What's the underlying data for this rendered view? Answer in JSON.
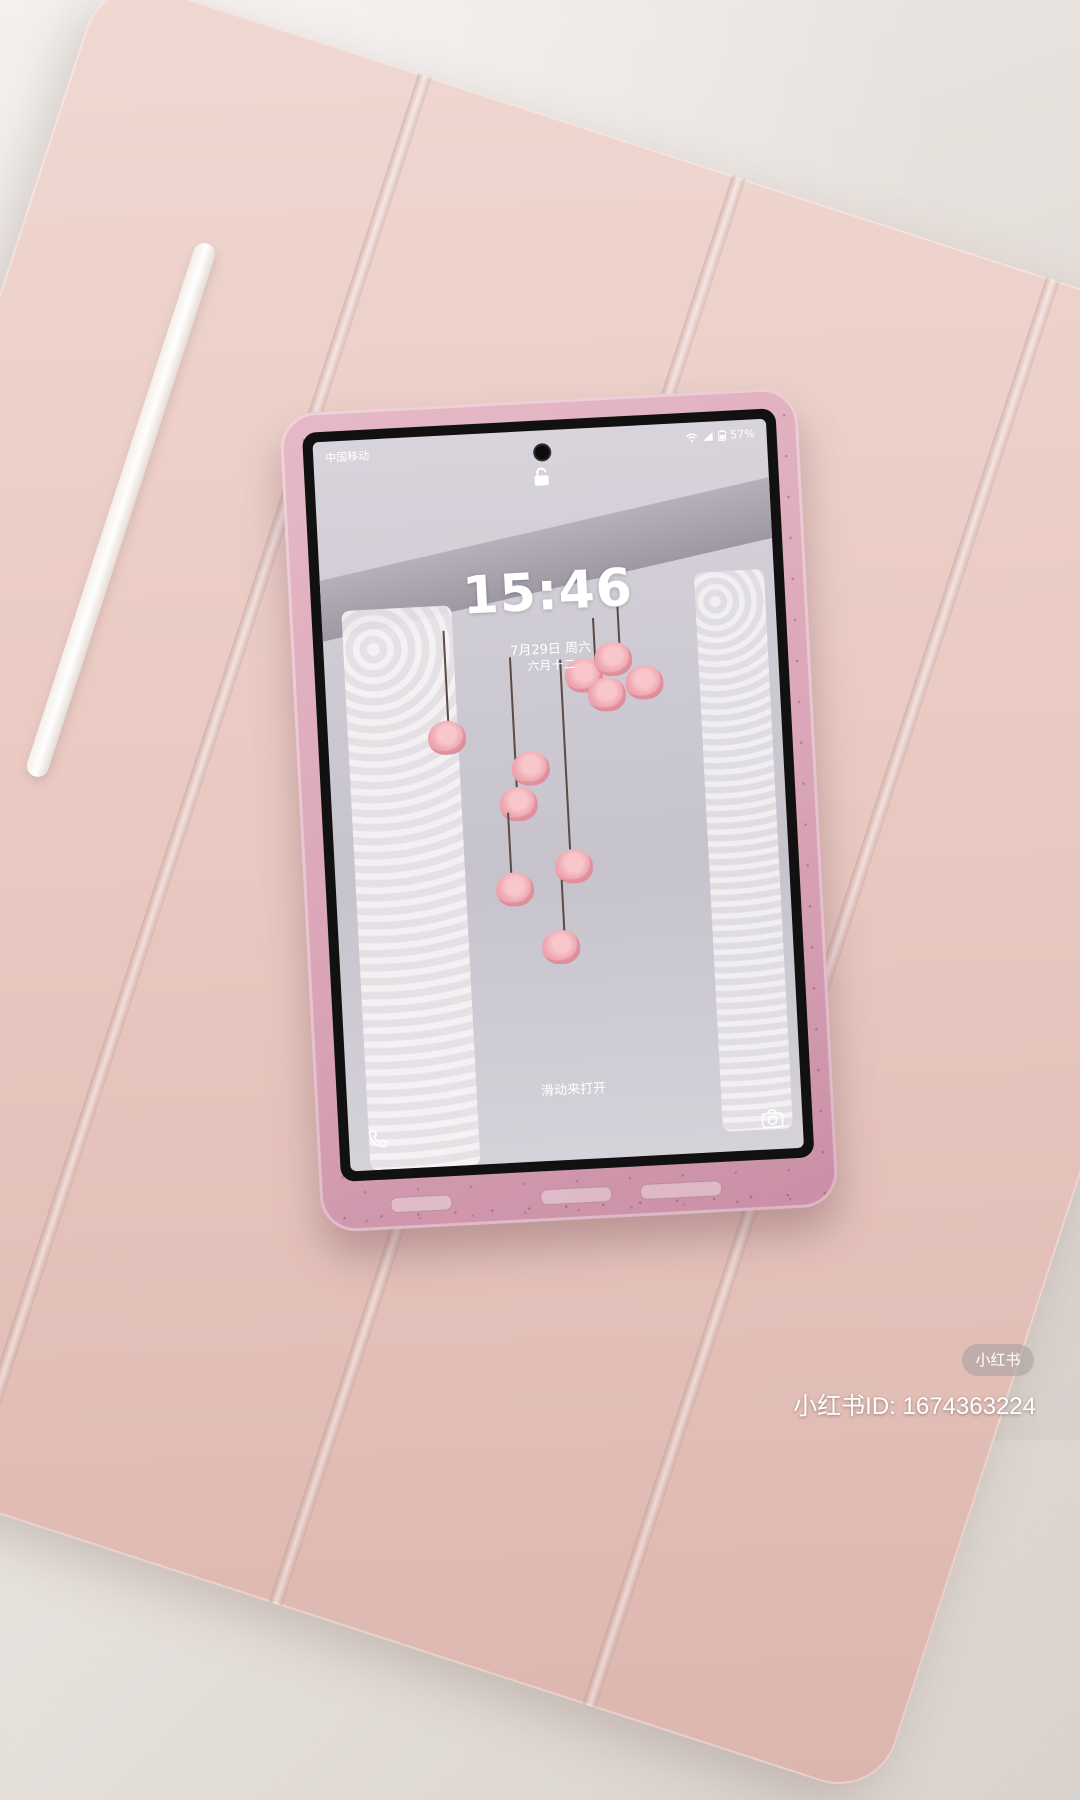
{
  "lockscreen": {
    "carrier": "中国移动",
    "battery": "57%",
    "time": "15:46",
    "date": "7月29日 周六",
    "lunar_date": "六月十二",
    "swipe_hint": "滑动来打开",
    "icons": {
      "lock": "unlock-icon",
      "phone": "phone-icon",
      "camera": "camera-icon",
      "wifi": "wifi-icon",
      "signal": "signal-icon",
      "battery": "battery-icon"
    }
  },
  "watermark": {
    "logo": "小红书",
    "id_text": "小红书ID: 1674363224"
  },
  "colors": {
    "case_pink": "#e9c9c2",
    "phone_case": "#d9a3b6",
    "rose": "#f0aab3"
  }
}
